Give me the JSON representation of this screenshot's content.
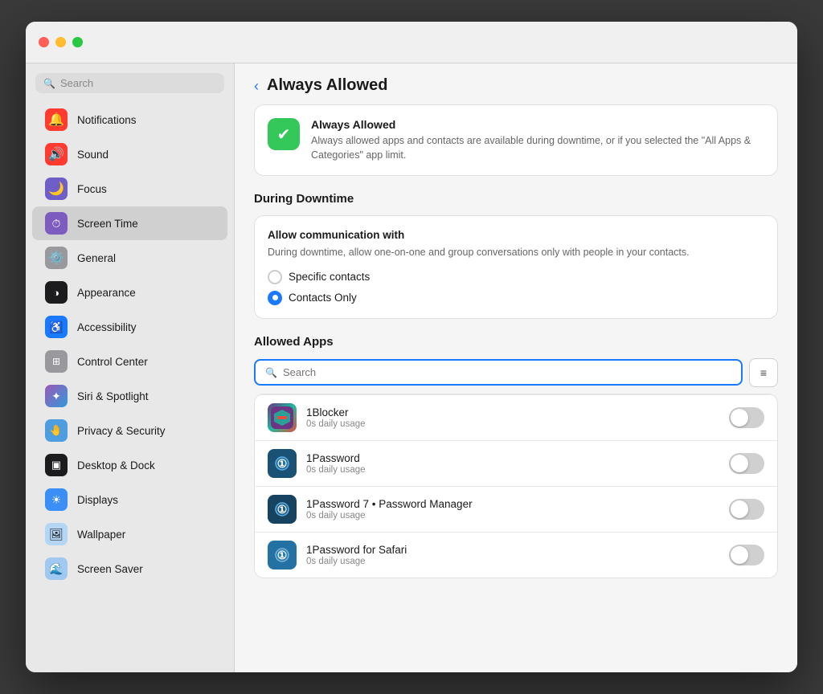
{
  "window": {
    "title": "Always Allowed"
  },
  "traffic_lights": {
    "close": "close",
    "minimize": "minimize",
    "maximize": "maximize"
  },
  "sidebar": {
    "search_placeholder": "Search",
    "items": [
      {
        "id": "notifications",
        "label": "Notifications",
        "icon_class": "icon-notifications",
        "icon": "🔔",
        "active": false
      },
      {
        "id": "sound",
        "label": "Sound",
        "icon_class": "icon-sound",
        "icon": "🔊",
        "active": false
      },
      {
        "id": "focus",
        "label": "Focus",
        "icon_class": "icon-focus",
        "icon": "🌙",
        "active": false
      },
      {
        "id": "screentime",
        "label": "Screen Time",
        "icon_class": "icon-screentime",
        "icon": "⏱",
        "active": true
      },
      {
        "id": "general",
        "label": "General",
        "icon_class": "icon-general",
        "icon": "⚙️",
        "active": false
      },
      {
        "id": "appearance",
        "label": "Appearance",
        "icon_class": "icon-appearance",
        "icon": "🌓",
        "active": false
      },
      {
        "id": "accessibility",
        "label": "Accessibility",
        "icon_class": "icon-accessibility",
        "icon": "♿",
        "active": false
      },
      {
        "id": "controlcenter",
        "label": "Control Center",
        "icon_class": "icon-controlcenter",
        "icon": "⊞",
        "active": false
      },
      {
        "id": "siri",
        "label": "Siri & Spotlight",
        "icon_class": "icon-siri",
        "icon": "✦",
        "active": false
      },
      {
        "id": "privacy",
        "label": "Privacy & Security",
        "icon_class": "icon-privacy",
        "icon": "🤚",
        "active": false
      },
      {
        "id": "desktop",
        "label": "Desktop & Dock",
        "icon_class": "icon-desktop",
        "icon": "▣",
        "active": false
      },
      {
        "id": "displays",
        "label": "Displays",
        "icon_class": "icon-displays",
        "icon": "☀",
        "active": false
      },
      {
        "id": "wallpaper",
        "label": "Wallpaper",
        "icon_class": "icon-wallpaper",
        "icon": "🖼",
        "active": false
      },
      {
        "id": "screensaver",
        "label": "Screen Saver",
        "icon_class": "icon-screensaver",
        "icon": "🌊",
        "active": false
      }
    ]
  },
  "main": {
    "back_button": "‹",
    "title": "Always Allowed",
    "info_card": {
      "icon": "✔",
      "title": "Always Allowed",
      "description": "Always allowed apps and contacts are available during downtime, or if you selected the \"All Apps & Categories\" app limit."
    },
    "during_downtime": {
      "section_title": "During Downtime",
      "allow_comm_title": "Allow communication with",
      "allow_comm_desc": "During downtime, allow one-on-one and group conversations only with people in your contacts.",
      "radio_options": [
        {
          "id": "specific",
          "label": "Specific contacts",
          "selected": false
        },
        {
          "id": "contacts_only",
          "label": "Contacts Only",
          "selected": true
        }
      ]
    },
    "allowed_apps": {
      "section_title": "Allowed Apps",
      "search_placeholder": "Search",
      "apps": [
        {
          "id": "1blocker",
          "name": "1Blocker",
          "usage": "0s daily usage",
          "enabled": false,
          "icon_class": "app-1blocker",
          "icon": "◼"
        },
        {
          "id": "1password",
          "name": "1Password",
          "usage": "0s daily usage",
          "enabled": false,
          "icon_class": "app-1password",
          "icon": "①"
        },
        {
          "id": "1password7",
          "name": "1Password 7 • Password Manager",
          "usage": "0s daily usage",
          "enabled": false,
          "icon_class": "app-1password7",
          "icon": "①"
        },
        {
          "id": "1password-safari",
          "name": "1Password for Safari",
          "usage": "0s daily usage",
          "enabled": false,
          "icon_class": "app-1password-safari",
          "icon": "①"
        }
      ]
    }
  }
}
